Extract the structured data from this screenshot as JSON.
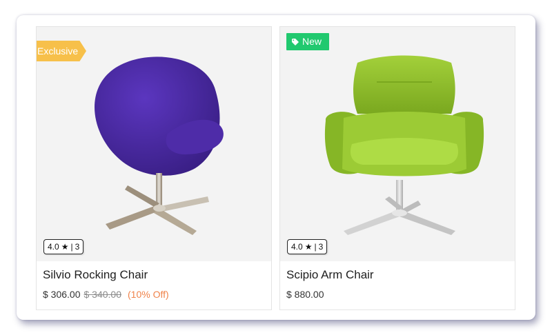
{
  "products": [
    {
      "badge": "Exclusive",
      "badge_color": "#f7c04a",
      "rating": "4.0",
      "rating_count": "3",
      "name": "Silvio Rocking Chair",
      "price": "$ 306.00",
      "old_price": "$ 340.00",
      "discount": "(10% Off)",
      "chair_color": "#4a2aa0"
    },
    {
      "badge": "New",
      "badge_color": "#21c96f",
      "badge_icon": "tag-icon",
      "rating": "4.0",
      "rating_count": "3",
      "name": "Scipio Arm Chair",
      "price": "$ 880.00",
      "chair_color": "#8fbf2a"
    }
  ],
  "rating_separator": "|",
  "star_icon": "star-icon"
}
